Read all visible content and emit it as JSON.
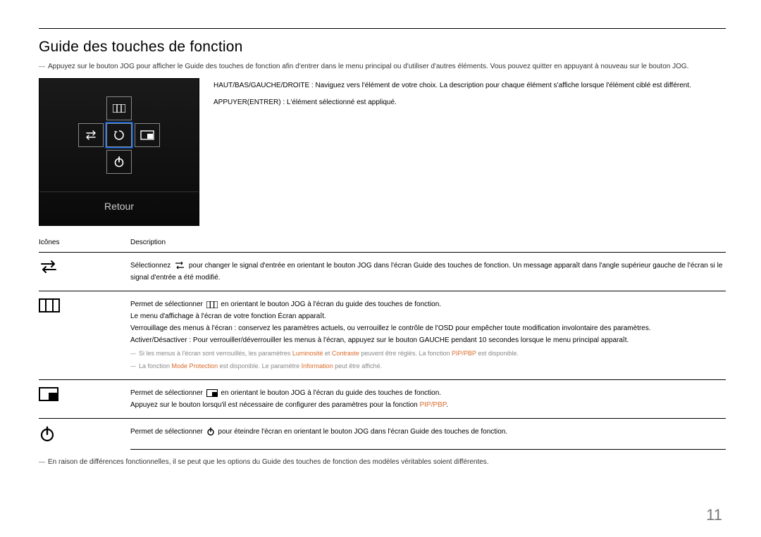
{
  "title": "Guide des touches de fonction",
  "intro_note": "Appuyez sur le bouton JOG pour afficher le Guide des touches de fonction afin d'entrer dans le menu principal ou d'utiliser d'autres éléments. Vous pouvez quitter en appuyant à nouveau sur le bouton JOG.",
  "osd": {
    "return_label": "Retour"
  },
  "instructions": {
    "nav": "HAUT/BAS/GAUCHE/DROITE : Naviguez vers l'élément de votre choix. La description pour chaque élément s'affiche lorsque l'élément ciblé est différent.",
    "enter": "APPUYER(ENTRER) : L'élément sélectionné est appliqué."
  },
  "table": {
    "head_icons": "Icônes",
    "head_desc": "Description",
    "row_source": {
      "pre": "Sélectionnez ",
      "post": " pour changer le signal d'entrée en orientant le bouton JOG dans l'écran Guide des touches de fonction. Un message apparaît dans l'angle supérieur gauche de l'écran si le signal d'entrée a été modifié."
    },
    "row_menu": {
      "l1a": "Permet de sélectionner ",
      "l1b": " en orientant le bouton JOG à l'écran du guide des touches de fonction.",
      "l2": "Le menu d'affichage à l'écran de votre fonction Écran apparaît.",
      "l3": "Verrouillage des menus à l'écran : conservez les paramètres actuels, ou verrouillez le contrôle de l'OSD pour empêcher toute modification involontaire des paramètres.",
      "l4": "Activer/Désactiver : Pour verrouiller/déverrouiller les menus à l'écran, appuyez sur le bouton GAUCHE pendant 10 secondes lorsque le menu principal apparaît.",
      "sub1_a": "Si les menus à l'écran sont verrouillés, les paramètres ",
      "sub1_b": "Luminosité",
      "sub1_c": " et ",
      "sub1_d": "Contraste",
      "sub1_e": " peuvent être réglés. La fonction ",
      "sub1_f": "PIP/PBP",
      "sub1_g": " est disponible.",
      "sub2_a": "La fonction ",
      "sub2_b": "Mode Protection",
      "sub2_c": " est disponible. Le paramètre ",
      "sub2_d": "Information",
      "sub2_e": " peut être affiché."
    },
    "row_pip": {
      "l1a": "Permet de sélectionner ",
      "l1b": " en orientant le bouton JOG à l'écran du guide des touches de fonction.",
      "l2a": "Appuyez sur le bouton lorsqu'il est nécessaire de configurer des paramètres pour la fonction ",
      "l2b": "PIP/PBP",
      "l2c": "."
    },
    "row_power": {
      "pre": "Permet de sélectionner ",
      "post": " pour éteindre l'écran en orientant le bouton JOG dans l'écran Guide des touches de fonction."
    }
  },
  "footer_note": "En raison de différences fonctionnelles, il se peut que les options du Guide des touches de fonction des modèles véritables soient différentes.",
  "page_number": "11"
}
